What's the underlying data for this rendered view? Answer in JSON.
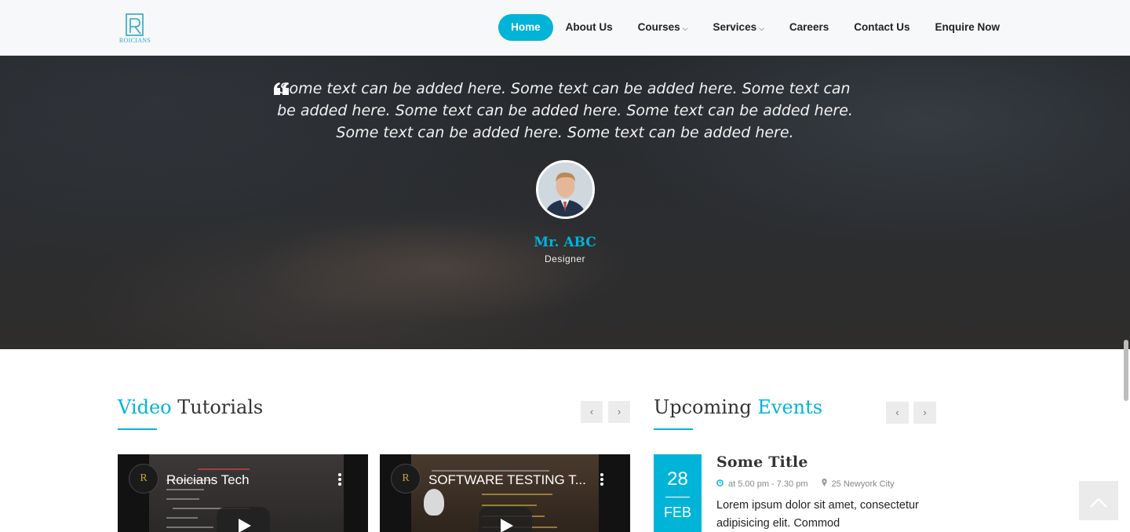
{
  "brand": {
    "name": "ROICIANS"
  },
  "nav": {
    "items": [
      {
        "label": "Home",
        "caret": ""
      },
      {
        "label": "About Us",
        "caret": ""
      },
      {
        "label": "Courses",
        "caret": "⌵"
      },
      {
        "label": "Services",
        "caret": "⌵"
      },
      {
        "label": "Careers",
        "caret": ""
      },
      {
        "label": "Contact Us",
        "caret": ""
      },
      {
        "label": "Enquire Now",
        "caret": ""
      }
    ],
    "active": "Home"
  },
  "testimonial": {
    "quote": "Some text can be added here. Some text can be added here. Some text can be added here. Some text can be added here. Some text can be added here. Some text can be added here. Some text can be added here.",
    "name": "Mr. ABC",
    "role": "Designer"
  },
  "videos": {
    "title_accent": "Video",
    "title_rest": " Tutorials",
    "prev_label": "‹",
    "next_label": "›",
    "items": [
      {
        "title": "Roicians Tech",
        "channel_logo": "R"
      },
      {
        "title": "SOFTWARE TESTING T...",
        "channel_logo": "R"
      }
    ]
  },
  "events": {
    "title_rest": "Upcoming ",
    "title_accent": "Events",
    "prev_label": "‹",
    "next_label": "›",
    "items": [
      {
        "day": "28",
        "month": "FEB",
        "title": "Some Title",
        "time": "at 5.00 pm - 7.30 pm",
        "location": "25 Newyork City",
        "description": "Lorem ipsum dolor sit amet, consectetur adipisicing elit. Commod"
      }
    ]
  },
  "icons": {
    "quote": "quote-icon",
    "clock": "clock-icon",
    "pin": "map-pin-icon",
    "scroll_top": "chevron-up-icon"
  },
  "colors": {
    "accent": "#00b4d8",
    "header_bg": "#f7f8f9"
  }
}
